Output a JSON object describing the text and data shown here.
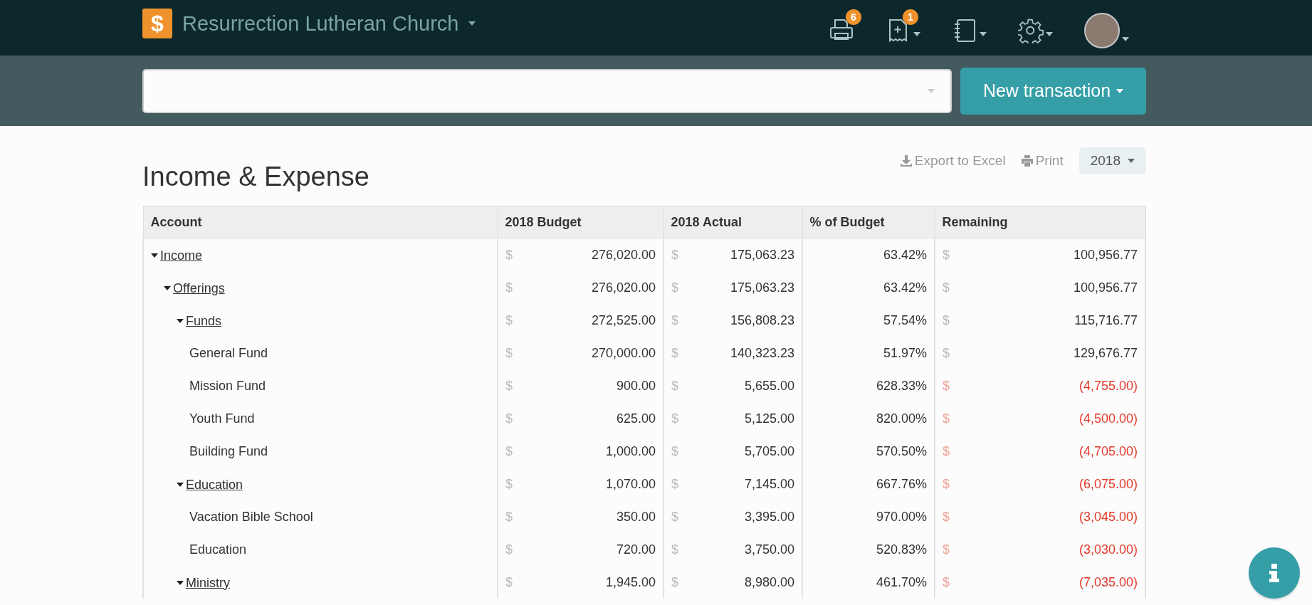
{
  "topbar": {
    "logo": "$",
    "org_name": "Resurrection Lutheran Church",
    "icons": [
      {
        "kind": "printer",
        "badge": "6",
        "menu": false
      },
      {
        "kind": "document-add",
        "badge": "1",
        "menu": true
      },
      {
        "kind": "notebook",
        "menu": true
      },
      {
        "kind": "gear",
        "menu": true
      },
      {
        "kind": "avatar",
        "menu": true
      }
    ]
  },
  "new_button": {
    "label": "New transaction"
  },
  "page": {
    "title": "Income & Expense",
    "actions": [
      {
        "kind": "export",
        "label": "Export to Excel"
      },
      {
        "kind": "print",
        "label": "Print"
      }
    ],
    "year": "2018"
  },
  "table": {
    "columns": [
      "Account",
      "2018 Budget",
      "2018 Actual",
      "% of Budget",
      "Remaining"
    ],
    "rows": [
      {
        "kind": "group",
        "name": "Income",
        "expanded": true,
        "budget": {
          "symbol": "$",
          "amount": "276,020.00"
        },
        "actual": {
          "symbol": "$",
          "amount": "175,063.23"
        },
        "percent": "63.42%",
        "remaining": {
          "symbol": "$",
          "amount": "100,956.77"
        },
        "negative": false,
        "children": [
          {
            "kind": "group",
            "name": "Offerings",
            "expanded": true,
            "budget": {
              "symbol": "$",
              "amount": "276,020.00"
            },
            "actual": {
              "symbol": "$",
              "amount": "175,063.23"
            },
            "percent": "63.42%",
            "remaining": {
              "symbol": "$",
              "amount": "100,956.77"
            },
            "negative": false,
            "children": [
              {
                "kind": "group",
                "name": "Funds",
                "expanded": true,
                "budget": {
                  "symbol": "$",
                  "amount": "272,525.00"
                },
                "actual": {
                  "symbol": "$",
                  "amount": "156,808.23"
                },
                "percent": "57.54%",
                "remaining": {
                  "symbol": "$",
                  "amount": "115,716.77"
                },
                "negative": false,
                "children": [
                  {
                    "kind": "account",
                    "name": "General Fund",
                    "budget": {
                      "symbol": "$",
                      "amount": "270,000.00"
                    },
                    "actual": {
                      "symbol": "$",
                      "amount": "140,323.23"
                    },
                    "percent": "51.97%",
                    "remaining": {
                      "symbol": "$",
                      "amount": "129,676.77"
                    },
                    "negative": false
                  },
                  {
                    "kind": "account",
                    "name": "Mission Fund",
                    "budget": {
                      "symbol": "$",
                      "amount": "900.00"
                    },
                    "actual": {
                      "symbol": "$",
                      "amount": "5,655.00"
                    },
                    "percent": "628.33%",
                    "remaining": {
                      "symbol": "$",
                      "amount": "(4,755.00)"
                    },
                    "negative": true
                  },
                  {
                    "kind": "account",
                    "name": "Youth Fund",
                    "budget": {
                      "symbol": "$",
                      "amount": "625.00"
                    },
                    "actual": {
                      "symbol": "$",
                      "amount": "5,125.00"
                    },
                    "percent": "820.00%",
                    "remaining": {
                      "symbol": "$",
                      "amount": "(4,500.00)"
                    },
                    "negative": true
                  },
                  {
                    "kind": "account",
                    "name": "Building Fund",
                    "budget": {
                      "symbol": "$",
                      "amount": "1,000.00"
                    },
                    "actual": {
                      "symbol": "$",
                      "amount": "5,705.00"
                    },
                    "percent": "570.50%",
                    "remaining": {
                      "symbol": "$",
                      "amount": "(4,705.00)"
                    },
                    "negative": true
                  }
                ]
              },
              {
                "kind": "group",
                "name": "Education",
                "expanded": true,
                "budget": {
                  "symbol": "$",
                  "amount": "1,070.00"
                },
                "actual": {
                  "symbol": "$",
                  "amount": "7,145.00"
                },
                "percent": "667.76%",
                "remaining": {
                  "symbol": "$",
                  "amount": "(6,075.00)"
                },
                "negative": true,
                "children": [
                  {
                    "kind": "account",
                    "name": "Vacation Bible School",
                    "budget": {
                      "symbol": "$",
                      "amount": "350.00"
                    },
                    "actual": {
                      "symbol": "$",
                      "amount": "3,395.00"
                    },
                    "percent": "970.00%",
                    "remaining": {
                      "symbol": "$",
                      "amount": "(3,045.00)"
                    },
                    "negative": true
                  },
                  {
                    "kind": "account",
                    "name": "Education",
                    "budget": {
                      "symbol": "$",
                      "amount": "720.00"
                    },
                    "actual": {
                      "symbol": "$",
                      "amount": "3,750.00"
                    },
                    "percent": "520.83%",
                    "remaining": {
                      "symbol": "$",
                      "amount": "(3,030.00)"
                    },
                    "negative": true
                  }
                ]
              },
              {
                "kind": "group",
                "name": "Ministry",
                "expanded": true,
                "budget": {
                  "symbol": "$",
                  "amount": "1,945.00"
                },
                "actual": {
                  "symbol": "$",
                  "amount": "8,980.00"
                },
                "percent": "461.70%",
                "remaining": {
                  "symbol": "$",
                  "amount": "(7,035.00)"
                },
                "negative": true
              }
            ]
          }
        ]
      }
    ]
  }
}
